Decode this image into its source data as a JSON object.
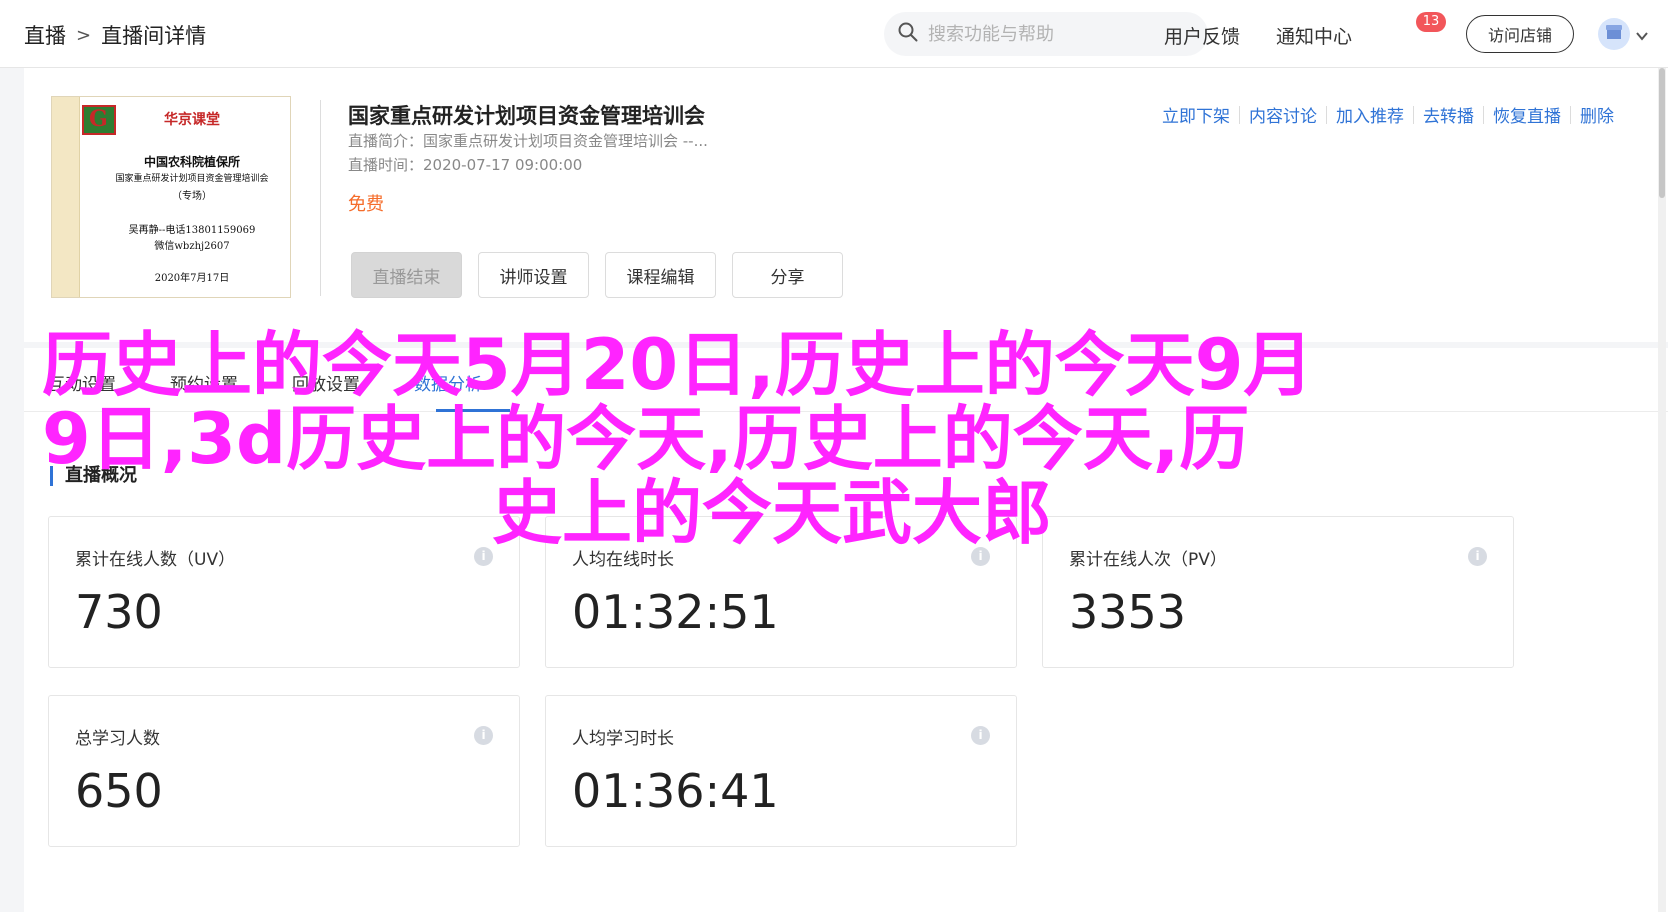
{
  "header": {
    "breadcrumb": [
      "直播",
      ">",
      "直播间详情"
    ],
    "search_placeholder": "搜索功能与帮助",
    "feedback": "用户反馈",
    "notifications": "通知中心",
    "notification_count": "13",
    "visit_store": "访问店铺"
  },
  "course": {
    "title": "国家重点研发计划项目资金管理培训会",
    "intro": "直播简介：国家重点研发计划项目资金管理培训会 --...",
    "time": "直播时间：2020-07-17 09:00:00",
    "price": "免费",
    "cover": {
      "brand": "华京课堂",
      "org": "中国农科院植保所",
      "subject": "国家重点研发计划项目资金管理培训会",
      "tag": "（专场）",
      "contact1": "吴再静--电话13801159069",
      "contact2": "微信wbzhj2607",
      "date": "2020年7月17日"
    },
    "buttons": {
      "end_live": "直播结束",
      "lecturer": "讲师设置",
      "edit": "课程编辑",
      "share": "分享"
    },
    "actions": [
      "立即下架",
      "内容讨论",
      "加入推荐",
      "去转播",
      "恢复直播",
      "删除"
    ]
  },
  "tabs": [
    "互动设置",
    "预约设置",
    "回放设置",
    "数据分析"
  ],
  "active_tab": "数据分析",
  "overview": {
    "title": "直播概况",
    "stats": [
      {
        "label": "累计在线人数（UV）",
        "value": "730"
      },
      {
        "label": "人均在线时长",
        "value": "01:32:51"
      },
      {
        "label": "累计在线人次（PV）",
        "value": "3353"
      },
      {
        "label": "总学习人数",
        "value": "650"
      },
      {
        "label": "人均学习时长",
        "value": "01:36:41"
      }
    ]
  },
  "watermark": {
    "line1": "历史上的今天5月20日,历史上的今天9月",
    "line2": "9日,3d历史上的今天,历史上的今天,历",
    "line3": "史上的今天武大郎"
  },
  "colors": {
    "accent": "#2f73d6",
    "price": "#f56c2a",
    "badge": "#f2565a",
    "watermark": "#ff24ff"
  }
}
